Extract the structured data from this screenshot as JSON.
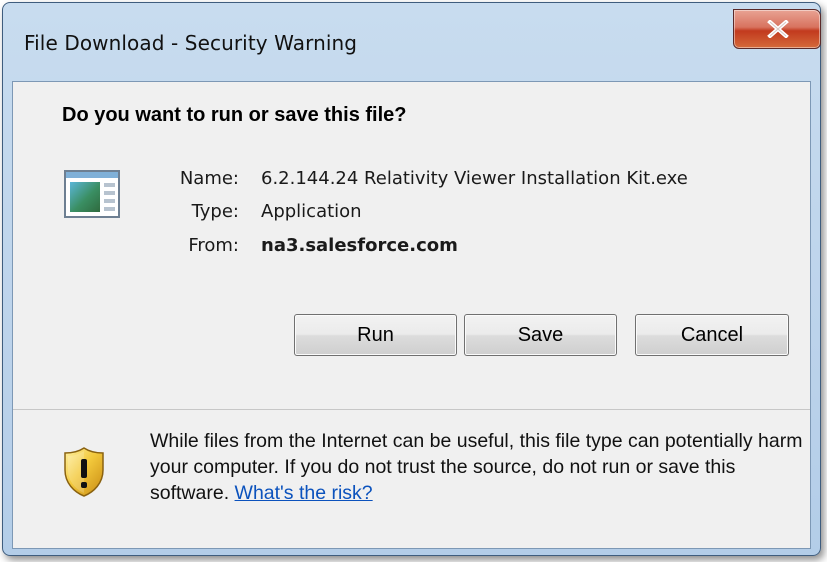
{
  "window": {
    "title": "File Download - Security Warning",
    "close_label": "close"
  },
  "prompt": {
    "heading": "Do you want to run or save this file?"
  },
  "file": {
    "icon": "application-window-icon",
    "fields": [
      {
        "label": "Name:",
        "value": "6.2.144.24 Relativity Viewer Installation Kit.exe"
      },
      {
        "label": "Type:",
        "value": "Application"
      },
      {
        "label": "From:",
        "value": "na3.salesforce.com"
      }
    ]
  },
  "buttons": {
    "run": "Run",
    "save": "Save",
    "cancel": "Cancel"
  },
  "warning": {
    "icon": "security-shield-icon",
    "text": "While files from the Internet can be useful, this file type can potentially harm your computer. If you do not trust the source, do not run or save this software.",
    "link": "What's the risk?"
  },
  "colors": {
    "link": "#0b52bd",
    "shield_gold": "#e8b830",
    "close_red": "#c23a1e"
  }
}
